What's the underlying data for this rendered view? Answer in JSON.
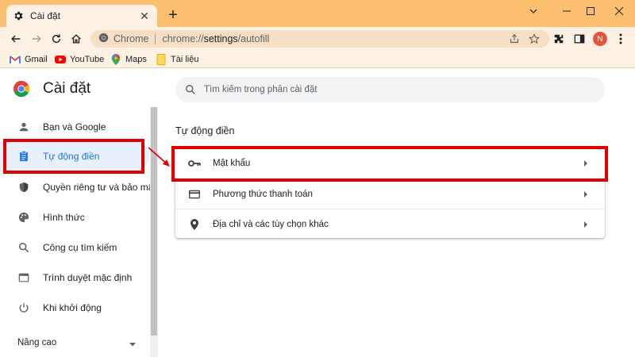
{
  "tab": {
    "title": "Cài đặt",
    "icon": "gear-icon"
  },
  "window_controls": [
    "chevron-down-icon",
    "minimize-icon",
    "maximize-icon",
    "close-icon"
  ],
  "omnibox": {
    "site_chip": "Chrome",
    "url_prefix": "chrome://",
    "url_host": "settings",
    "url_path": "/autofill"
  },
  "profile": {
    "initial": "N",
    "color": "#e2553a"
  },
  "bookmarks": [
    {
      "label": "Gmail",
      "icon": "gmail-icon"
    },
    {
      "label": "YouTube",
      "icon": "youtube-icon"
    },
    {
      "label": "Maps",
      "icon": "maps-icon"
    },
    {
      "label": "Tài liệu",
      "icon": "folder-icon"
    }
  ],
  "settings": {
    "title": "Cài đặt",
    "search_placeholder": "Tìm kiếm trong phần cài đặt",
    "sidebar": [
      {
        "label": "Bạn và Google",
        "icon": "person-icon",
        "active": false
      },
      {
        "label": "Tự động điền",
        "icon": "clipboard-icon",
        "active": true
      },
      {
        "label": "Quyền riêng tư và bảo mật",
        "icon": "shield-icon",
        "active": false
      },
      {
        "label": "Hình thức",
        "icon": "palette-icon",
        "active": false
      },
      {
        "label": "Công cụ tìm kiếm",
        "icon": "search-icon",
        "active": false
      },
      {
        "label": "Trình duyệt mặc định",
        "icon": "browser-icon",
        "active": false
      },
      {
        "label": "Khi khởi động",
        "icon": "power-icon",
        "active": false
      }
    ],
    "advanced_label": "Nâng cao",
    "section_title": "Tự động điền",
    "rows": [
      {
        "label": "Mật khẩu",
        "icon": "key-icon"
      },
      {
        "label": "Phương thức thanh toán",
        "icon": "credit-card-icon"
      },
      {
        "label": "Địa chỉ và các tùy chọn khác",
        "icon": "location-pin-icon"
      }
    ]
  },
  "colors": {
    "accent": "#1a73e8",
    "annotation": "#e00000",
    "frame": "#fbbf6f"
  }
}
